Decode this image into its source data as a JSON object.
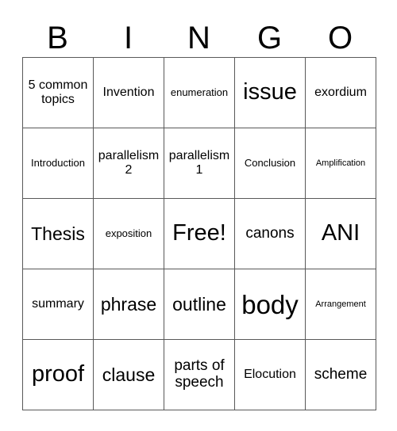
{
  "card": {
    "header_letters": [
      "B",
      "I",
      "N",
      "G",
      "O"
    ],
    "grid": {
      "rows": 5,
      "columns": 5,
      "border_color": "#595959",
      "cell_background": "#ffffff",
      "text_color": "#000000"
    },
    "cells": [
      [
        {
          "text": "5 common topics",
          "size": "md"
        },
        {
          "text": "Invention",
          "size": "md"
        },
        {
          "text": "enumeration",
          "size": "sm"
        },
        {
          "text": "issue",
          "size": "xxl"
        },
        {
          "text": "exordium",
          "size": "md"
        }
      ],
      [
        {
          "text": "Introduction",
          "size": "sm"
        },
        {
          "text": "parallelism 2",
          "size": "md"
        },
        {
          "text": "parallelism 1",
          "size": "md"
        },
        {
          "text": "Conclusion",
          "size": "sm"
        },
        {
          "text": "Amplification",
          "size": "xs"
        }
      ],
      [
        {
          "text": "Thesis",
          "size": "xl"
        },
        {
          "text": "exposition",
          "size": "sm"
        },
        {
          "text": "Free!",
          "size": "xxl"
        },
        {
          "text": "canons",
          "size": "lg"
        },
        {
          "text": "ANI",
          "size": "xxl"
        }
      ],
      [
        {
          "text": "summary",
          "size": "md"
        },
        {
          "text": "phrase",
          "size": "xl"
        },
        {
          "text": "outline",
          "size": "xl"
        },
        {
          "text": "body",
          "size": "huge"
        },
        {
          "text": "Arrangement",
          "size": "xs"
        }
      ],
      [
        {
          "text": "proof",
          "size": "xxl"
        },
        {
          "text": "clause",
          "size": "xl"
        },
        {
          "text": "parts of speech",
          "size": "lg"
        },
        {
          "text": "Elocution",
          "size": "md"
        },
        {
          "text": "scheme",
          "size": "lg"
        }
      ]
    ]
  }
}
